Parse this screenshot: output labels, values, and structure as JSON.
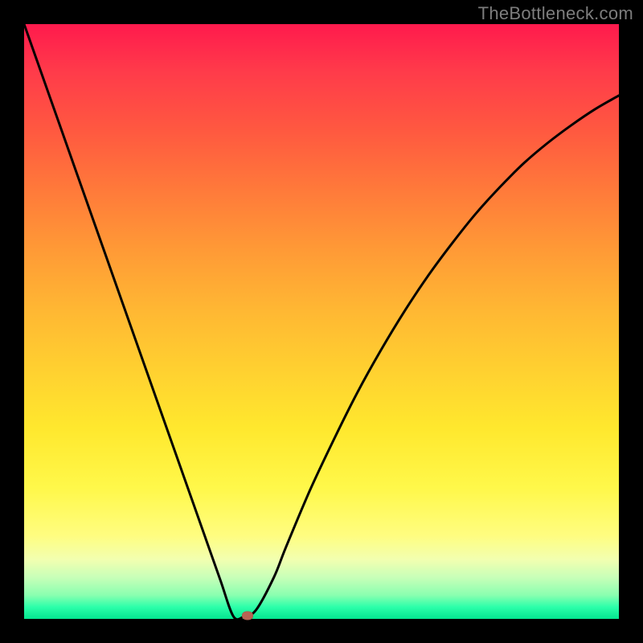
{
  "watermark": "TheBottleneck.com",
  "chart_data": {
    "type": "line",
    "title": "",
    "xlabel": "",
    "ylabel": "",
    "xlim": [
      0,
      1
    ],
    "ylim": [
      0,
      1
    ],
    "series": [
      {
        "name": "bottleneck-curve",
        "x": [
          0.0,
          0.03,
          0.06,
          0.09,
          0.12,
          0.15,
          0.18,
          0.21,
          0.24,
          0.27,
          0.3,
          0.33,
          0.352,
          0.37,
          0.39,
          0.42,
          0.44,
          0.48,
          0.52,
          0.56,
          0.6,
          0.64,
          0.68,
          0.72,
          0.76,
          0.8,
          0.84,
          0.88,
          0.92,
          0.96,
          1.0
        ],
        "y": [
          1.0,
          0.915,
          0.83,
          0.745,
          0.66,
          0.575,
          0.49,
          0.405,
          0.32,
          0.235,
          0.15,
          0.065,
          0.004,
          0.004,
          0.015,
          0.07,
          0.12,
          0.215,
          0.3,
          0.38,
          0.452,
          0.518,
          0.578,
          0.632,
          0.682,
          0.726,
          0.766,
          0.8,
          0.83,
          0.857,
          0.88
        ]
      }
    ],
    "marker": {
      "x": 0.375,
      "y": 0.006,
      "color": "#b76353"
    },
    "background_gradient": {
      "top": "#ff1a4d",
      "mid": "#ffe82e",
      "bottom": "#04e58f"
    }
  }
}
